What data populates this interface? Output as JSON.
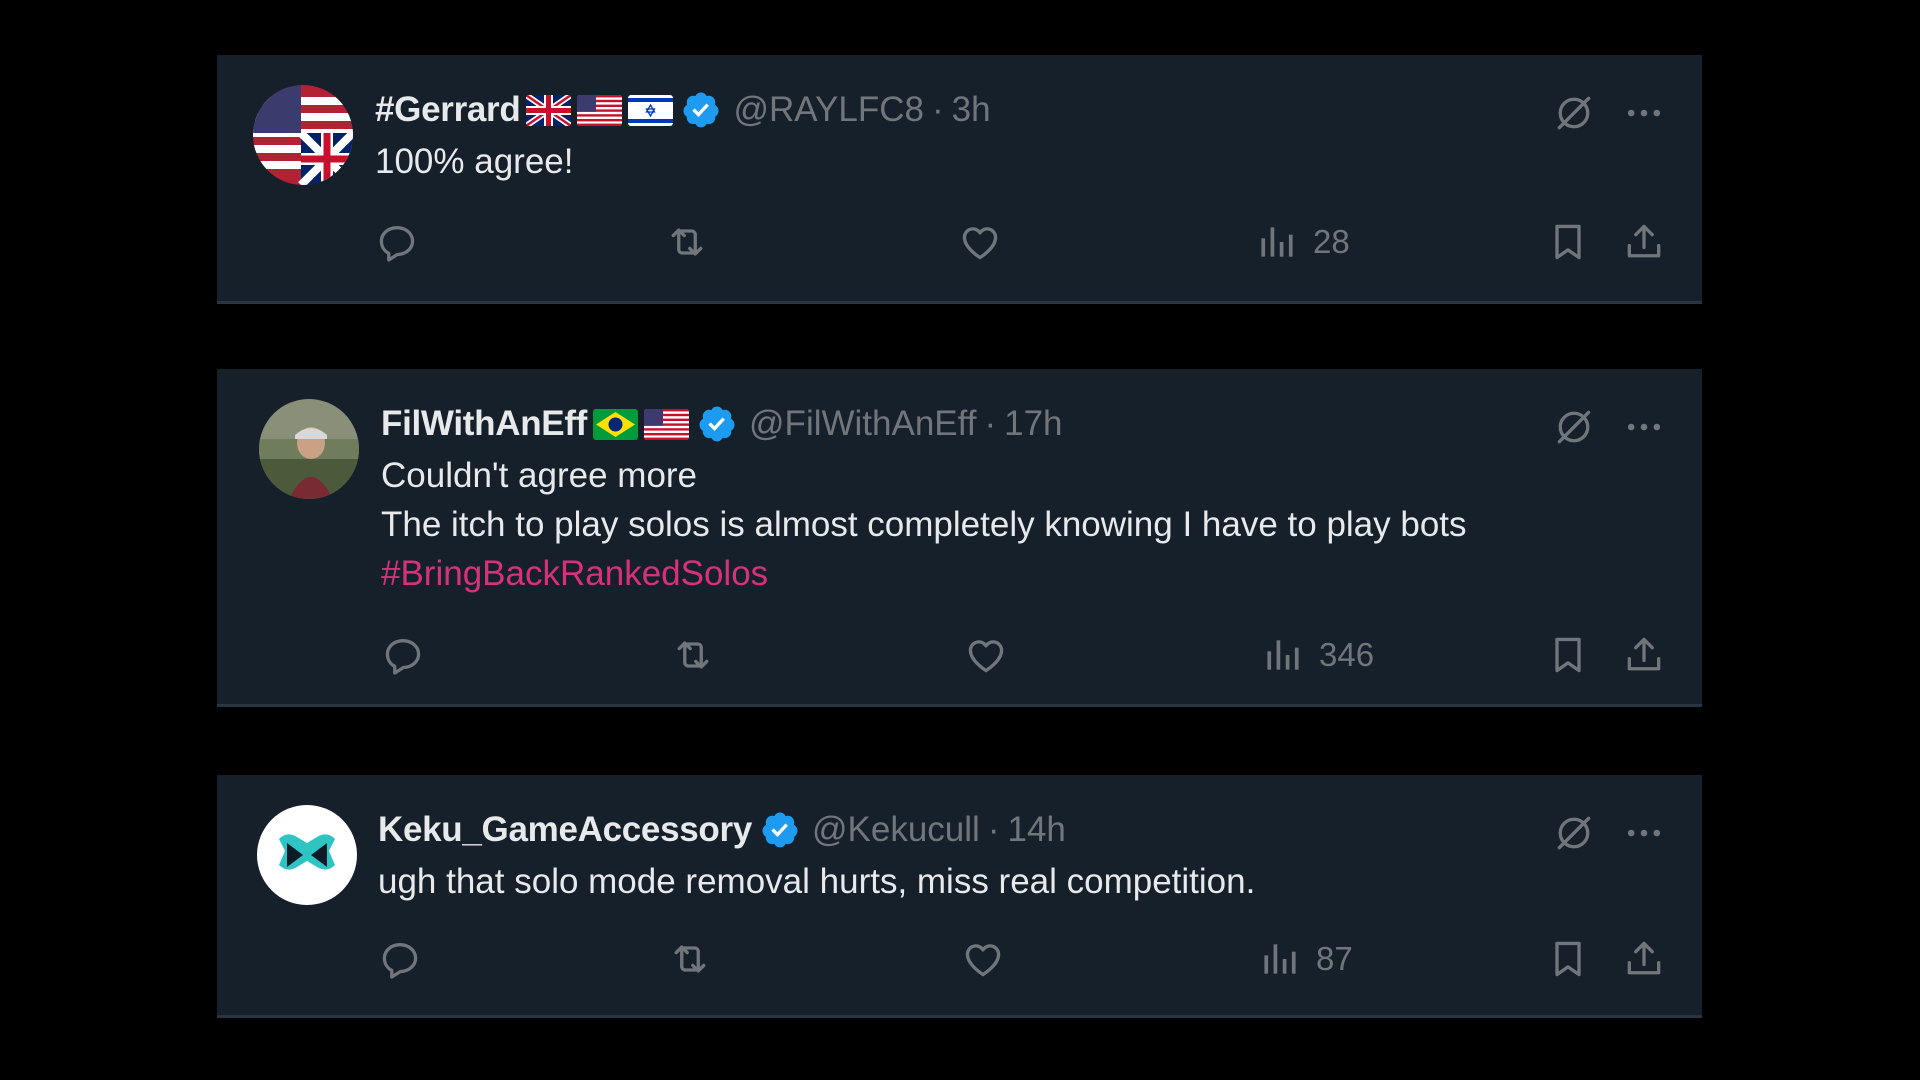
{
  "tweets": [
    {
      "display_name": "#Gerrard",
      "flags": [
        "uk-flag",
        "us-flag",
        "israel-flag"
      ],
      "verified": true,
      "handle": "@RAYLFC8",
      "separator": "·",
      "time": "3h",
      "text_lines": [
        "100% agree!"
      ],
      "hashtag": "",
      "views": "28",
      "avatar": "flag-avatar"
    },
    {
      "display_name": "FilWithAnEff",
      "flags": [
        "brazil-flag",
        "us-flag"
      ],
      "verified": true,
      "handle": "@FilWithAnEff",
      "separator": "·",
      "time": "17h",
      "text_lines": [
        "Couldn't agree more",
        "The itch to play solos is almost completely knowing I have to play bots"
      ],
      "hashtag": "#BringBackRankedSolos",
      "views": "346",
      "avatar": "photo-avatar"
    },
    {
      "display_name": "Keku_GameAccessory",
      "flags": [],
      "verified": true,
      "handle": "@Kekucull",
      "separator": "·",
      "time": "14h",
      "text_lines": [
        "ugh that solo mode removal hurts, miss real competition."
      ],
      "hashtag": "",
      "views": "87",
      "avatar": "gamepad-logo-avatar"
    }
  ],
  "colors": {
    "background": "#000000",
    "card": "#16202b",
    "text": "#e7e9ea",
    "muted": "#71767b",
    "verified": "#1d9bf0",
    "hashtag": "#d6317a"
  },
  "icons": {
    "reply": "reply-icon",
    "retweet": "retweet-icon",
    "like": "heart-icon",
    "views": "views-chart-icon",
    "bookmark": "bookmark-icon",
    "share": "share-icon",
    "grok": "grok-icon",
    "more": "more-icon",
    "verified": "verified-badge-icon"
  }
}
